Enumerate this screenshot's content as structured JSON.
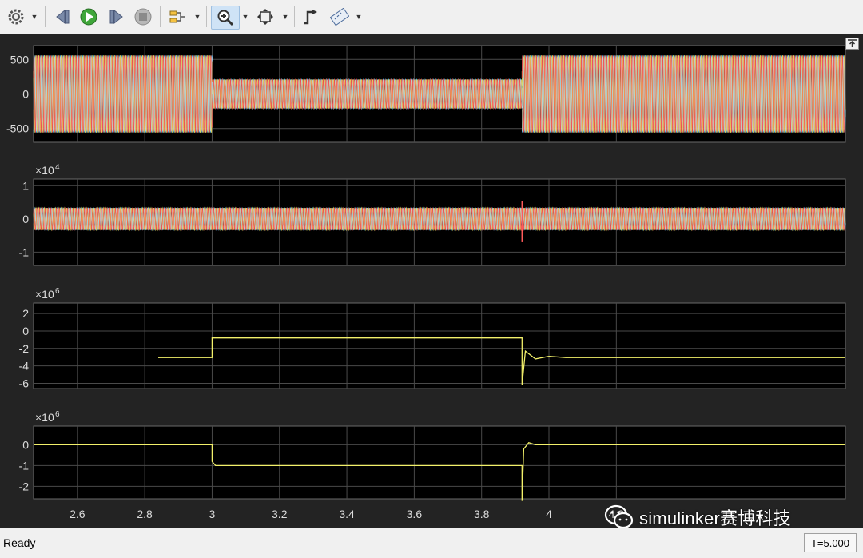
{
  "toolbar": {
    "buttons": [
      "settings",
      "step-back",
      "run",
      "step-forward",
      "stop",
      "highlight-signal",
      "zoom-in",
      "zoom-to-fit",
      "cursor-measure",
      "triggers"
    ]
  },
  "status": {
    "text": "Ready",
    "time": "T=5.000"
  },
  "watermark": {
    "text": "simulinker赛博科技"
  },
  "colors": {
    "plot_bg": "#000000",
    "panel_bg": "#232323",
    "grid": "#4a4a4a",
    "axis_text": "#dcdcdc",
    "series": [
      "#f2f06a",
      "#55c7ff",
      "#ff5a5a",
      "#ffffff",
      "#ffa640"
    ]
  },
  "chart_data": [
    {
      "type": "line",
      "xlim": [
        2.47,
        4.88
      ],
      "ylim": [
        -700,
        700
      ],
      "yticks": [
        500,
        0,
        -500
      ],
      "ytick_labels": [
        "500",
        "0",
        "-500"
      ],
      "exponent_label": "",
      "grid": true,
      "series_desc": "three-phase oscillation",
      "segments": [
        {
          "x": [
            2.47,
            3.0
          ],
          "amplitude": 560
        },
        {
          "x": [
            3.0,
            3.92
          ],
          "amplitude": 210
        },
        {
          "x": [
            3.92,
            4.88
          ],
          "amplitude": 560
        }
      ]
    },
    {
      "type": "line",
      "xlim": [
        2.47,
        4.88
      ],
      "ylim": [
        -1.4,
        1.2
      ],
      "yticks": [
        1,
        0,
        -1
      ],
      "ytick_labels": [
        "1",
        "0",
        "-1"
      ],
      "exponent_label": "×10",
      "exponent_power": "4",
      "grid": true,
      "segments": [
        {
          "x": [
            2.47,
            4.88
          ],
          "amplitude": 0.33
        }
      ],
      "spike": {
        "x": 3.92,
        "min": -0.7,
        "max": 0.55
      }
    },
    {
      "type": "line",
      "xlim": [
        2.47,
        4.88
      ],
      "ylim": [
        -6.6,
        3.2
      ],
      "yticks": [
        2,
        0,
        -2,
        -4,
        -6
      ],
      "ytick_labels": [
        "2",
        "0",
        "-2",
        "-4",
        "-6"
      ],
      "exponent_label": "×10",
      "exponent_power": "6",
      "grid": true,
      "points": [
        [
          2.84,
          -3.05
        ],
        [
          3.0,
          -3.05
        ],
        [
          3.0,
          -0.8
        ],
        [
          3.92,
          -0.8
        ],
        [
          3.92,
          -6.2
        ],
        [
          3.93,
          -2.3
        ],
        [
          3.96,
          -3.2
        ],
        [
          4.0,
          -2.9
        ],
        [
          4.05,
          -3.05
        ],
        [
          4.88,
          -3.05
        ]
      ]
    },
    {
      "type": "line",
      "xlim": [
        2.47,
        4.88
      ],
      "ylim": [
        -2.6,
        0.9
      ],
      "yticks": [
        0,
        -1,
        -2
      ],
      "ytick_labels": [
        "0",
        "-1",
        "-2"
      ],
      "exponent_label": "×10",
      "exponent_power": "6",
      "grid": true,
      "xticks": [
        2.6,
        2.8,
        3.0,
        3.2,
        3.4,
        3.6,
        3.8,
        4.0,
        4.2
      ],
      "xtick_labels": [
        "2.6",
        "2.8",
        "3",
        "3.2",
        "3.4",
        "3.6",
        "3.8",
        "4",
        "4.2"
      ],
      "points": [
        [
          2.47,
          0
        ],
        [
          3.0,
          0
        ],
        [
          3.0,
          -0.8
        ],
        [
          3.01,
          -1.0
        ],
        [
          3.92,
          -1.0
        ],
        [
          3.92,
          -2.7
        ],
        [
          3.925,
          -0.2
        ],
        [
          3.94,
          0.1
        ],
        [
          3.96,
          0.0
        ],
        [
          4.88,
          0.0
        ]
      ]
    }
  ]
}
